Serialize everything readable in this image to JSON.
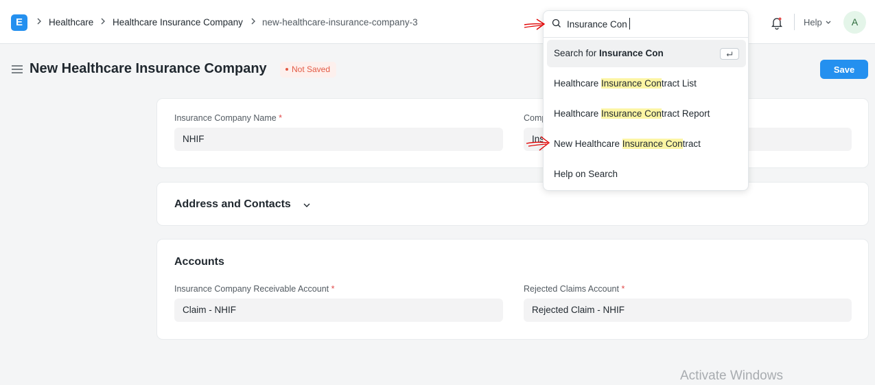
{
  "navbar": {
    "logo_letter": "E",
    "breadcrumbs": [
      "Healthcare",
      "Healthcare Insurance Company",
      "new-healthcare-insurance-company-3"
    ],
    "help_label": "Help",
    "avatar_initial": "A"
  },
  "page": {
    "title": "New Healthcare Insurance Company",
    "status_badge": "Not Saved",
    "save_label": "Save"
  },
  "details": {
    "company_name_label": "Insurance Company Name",
    "company_name_value": "NHIF",
    "second_label_partial": "Comp",
    "second_value_partial": "Ins"
  },
  "address_section": {
    "title": "Address and Contacts"
  },
  "accounts": {
    "title": "Accounts",
    "receivable_label": "Insurance Company Receivable Account",
    "receivable_value": "Claim - NHIF",
    "rejected_label": "Rejected Claims Account",
    "rejected_value": "Rejected Claim - NHIF"
  },
  "search": {
    "query": "Insurance Con",
    "search_for_prefix": "Search for ",
    "search_for_term": "Insurance Con",
    "results": [
      {
        "before": "Healthcare ",
        "match": "Insurance Con",
        "after": "tract List"
      },
      {
        "before": "Healthcare ",
        "match": "Insurance Con",
        "after": "tract Report"
      },
      {
        "before": "New Healthcare ",
        "match": "Insurance Con",
        "after": "tract"
      }
    ],
    "help_on_search": "Help on Search"
  },
  "watermark": "Activate Windows",
  "colors": {
    "primary": "#2490ef",
    "highlight": "#fcf5a4",
    "badge_text": "#e35a44",
    "annotation_arrow": "#e00000"
  }
}
